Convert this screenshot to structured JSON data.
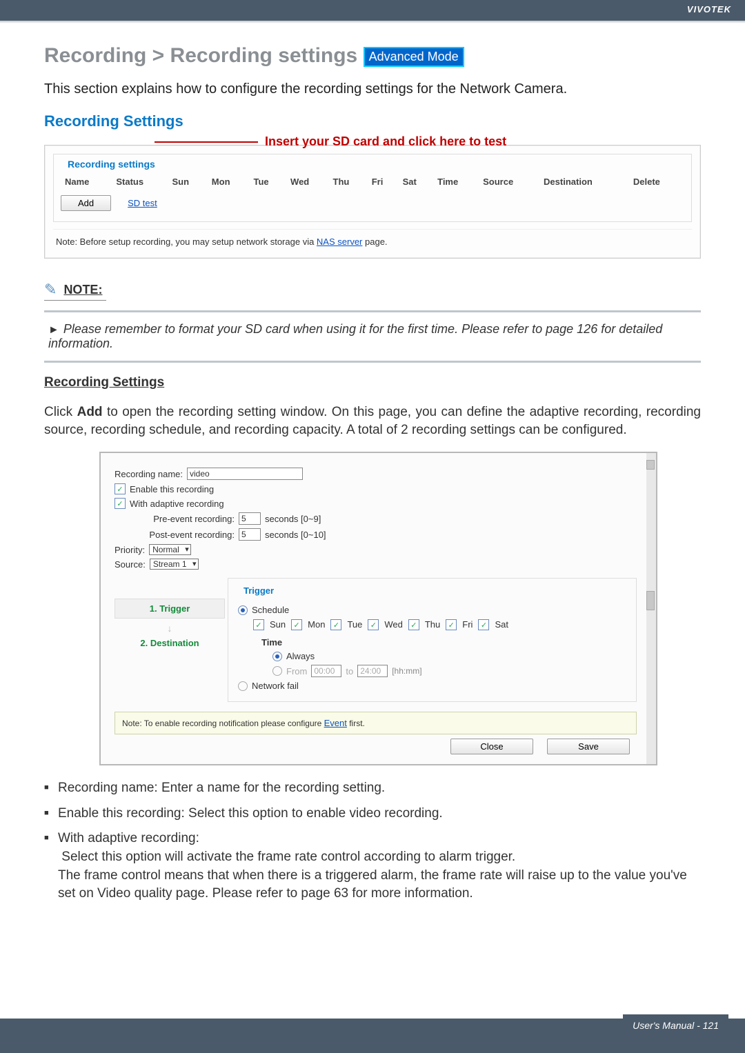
{
  "brand": "VIVOTEK",
  "title_prefix": "Recording > Recording settings",
  "adv_mode": "Advanced Mode",
  "lead": "This section explains how to configure the recording settings for the Network Camera.",
  "sec_heading": "Recording Settings",
  "callout": "Insert your SD card and click here to test",
  "panel1": {
    "legend": "Recording settings",
    "cols": [
      "Name",
      "Status",
      "Sun",
      "Mon",
      "Tue",
      "Wed",
      "Thu",
      "Fri",
      "Sat",
      "Time",
      "Source",
      "Destination",
      "Delete"
    ],
    "add_btn": "Add",
    "sd_link": "SD test",
    "note_pre": "Note: Before setup recording, you may setup network storage via ",
    "note_link": "NAS server",
    "note_post": " page."
  },
  "note_label": "NOTE:",
  "note_body": "Please remember to format your SD card when using it for the first time. Please refer to page 126 for detailed information.",
  "sub_heading": "Recording Settings",
  "body1_pre": "Click ",
  "body1_b": "Add",
  "body1_post": " to open the recording setting window. On this page, you can define the adaptive recording, recording source, recording schedule, and recording capacity. A total of 2 recording settings can be configured.",
  "shot": {
    "rec_name_lbl": "Recording name:",
    "rec_name_val": "video",
    "enable_lbl": "Enable this recording",
    "adaptive_lbl": "With adaptive recording",
    "pre_lbl": "Pre-event recording:",
    "pre_val": "5",
    "pre_range": "seconds [0~9]",
    "post_lbl": "Post-event recording:",
    "post_val": "5",
    "post_range": "seconds [0~10]",
    "priority_lbl": "Priority:",
    "priority_val": "Normal",
    "source_lbl": "Source:",
    "source_val": "Stream 1",
    "step1": "1. Trigger",
    "step2": "2. Destination",
    "trigger_leg": "Trigger",
    "schedule": "Schedule",
    "days": [
      "Sun",
      "Mon",
      "Tue",
      "Wed",
      "Thu",
      "Fri",
      "Sat"
    ],
    "time_lbl": "Time",
    "always": "Always",
    "from": "From",
    "from_val": "00:00",
    "to": "to",
    "to_val": "24:00",
    "hhmm": "[hh:mm]",
    "netfail": "Network fail",
    "note2_pre": "Note: To enable recording notification please configure ",
    "note2_link": "Event",
    "note2_post": " first.",
    "close": "Close",
    "save": "Save"
  },
  "bullets": {
    "b1": "Recording name: Enter a name for the recording setting.",
    "b2": "Enable this recording: Select this option to enable video recording.",
    "b3a": "With adaptive recording:",
    "b3b": "Select this option will activate the frame rate control according to alarm trigger.",
    "b3c": "The frame control means that when there is a triggered alarm, the frame rate will raise up to the value you've set on Video quality page. Please refer to page 63 for more information."
  },
  "footer": "User's Manual - 121"
}
